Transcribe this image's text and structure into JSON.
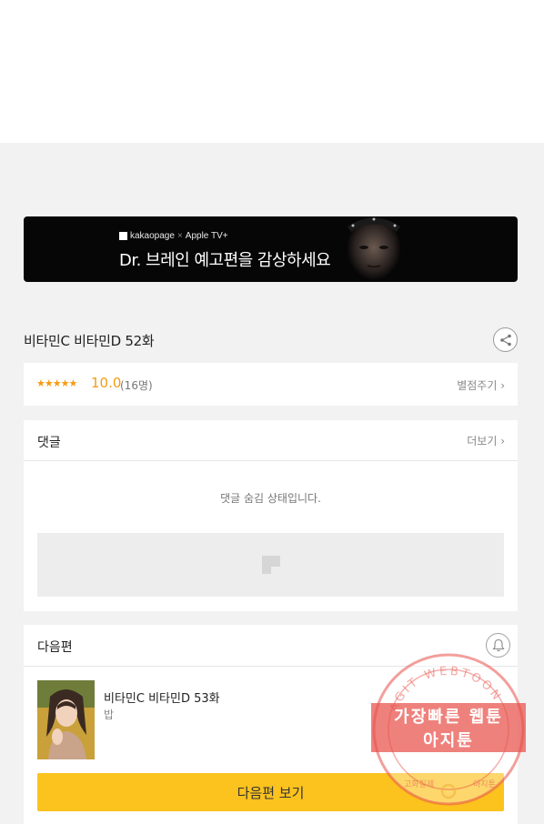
{
  "banner": {
    "brand_left": "kakaopage",
    "brand_x": "×",
    "brand_right": "Apple TV+",
    "headline": "Dr. 브레인 예고편을 감상하세요"
  },
  "episode": {
    "title": "비타민C 비타민D 52화"
  },
  "rating": {
    "stars": "★★★★★",
    "score": "10.0",
    "count": "(16명)",
    "rate_link": "별점주기 ›"
  },
  "comments": {
    "label": "댓글",
    "more": "더보기 ›",
    "hidden_message": "댓글 숨김 상태입니다."
  },
  "next": {
    "label": "다음편",
    "title": "비타민C 비타민D 53화",
    "subtitle": "밥",
    "button": "다음편 보기"
  },
  "watermark": {
    "ring_text": "AGIT WEBTOON",
    "line1": "가장빠른 웹툰",
    "line2": "아지툰",
    "bottom_left": "고화질제",
    "bottom_right": "아지툰"
  },
  "colors": {
    "accent_yellow": "#fcc21e",
    "rating_orange": "#f39c12",
    "watermark_red": "#e8514a"
  }
}
